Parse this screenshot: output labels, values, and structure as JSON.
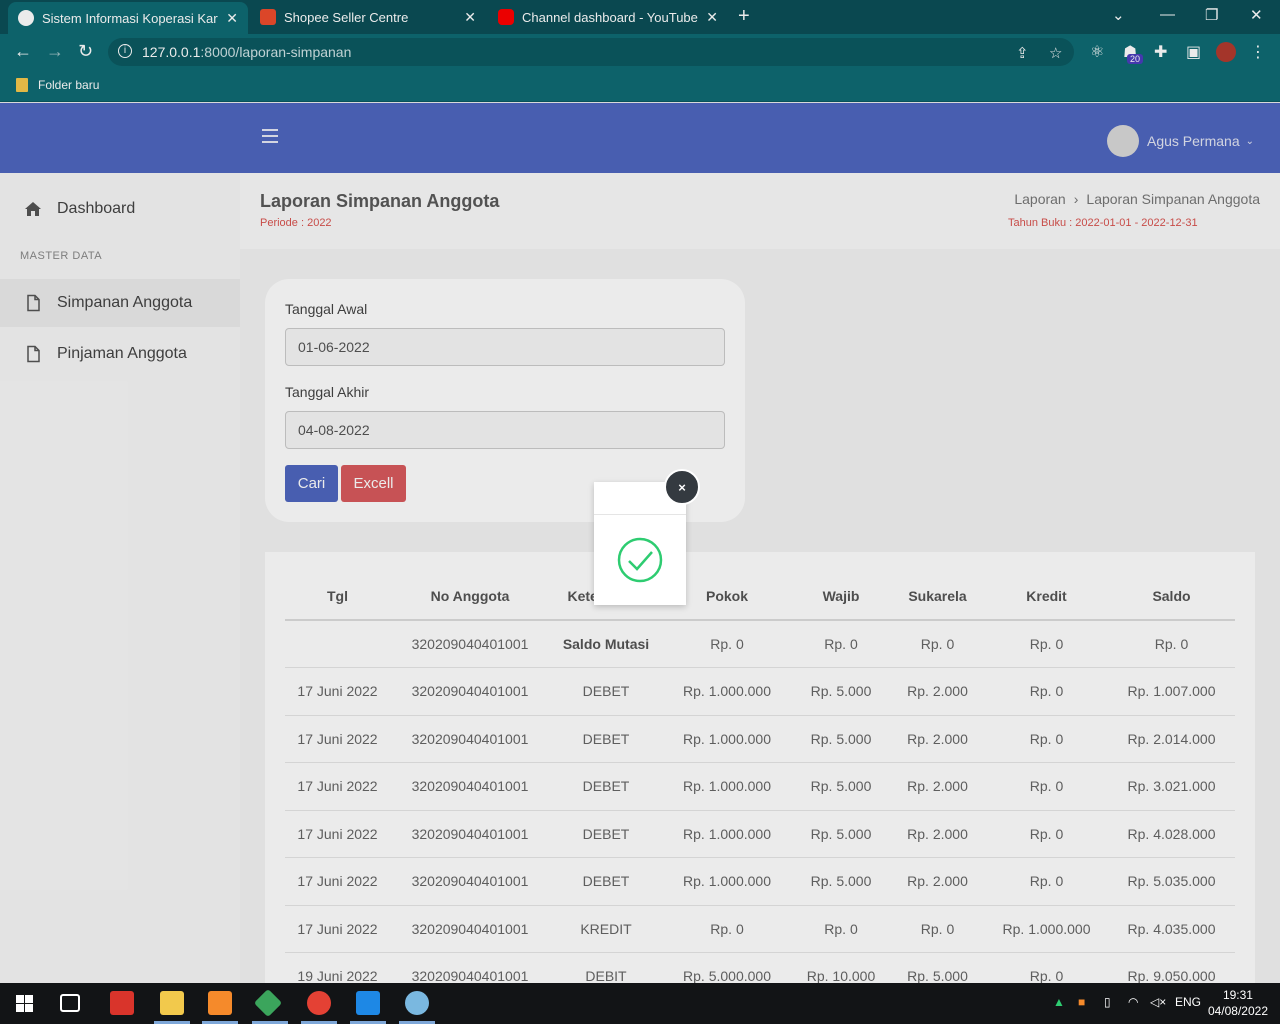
{
  "browser": {
    "tabs": [
      {
        "title": "Sistem Informasi Koperasi Karyaw",
        "active": true
      },
      {
        "title": "Shopee Seller Centre",
        "active": false
      },
      {
        "title": "Channel dashboard - YouTube St",
        "active": false
      }
    ],
    "url_host": "127.0.0.1",
    "url_path": ":8000/laporan-simpanan",
    "extension_badge": "20",
    "bookmark": "Folder baru"
  },
  "app": {
    "user_name": "Agus Permana",
    "sidebar": {
      "dashboard": "Dashboard",
      "section": "MASTER DATA",
      "simpanan": "Simpanan Anggota",
      "pinjaman": "Pinjaman Anggota"
    },
    "header": {
      "title": "Laporan Simpanan Anggota",
      "periode": "Periode : 2022",
      "crumb_parent": "Laporan",
      "crumb_current": "Laporan Simpanan Anggota",
      "tahun_buku": "Tahun Buku : 2022-01-01 - 2022-12-31"
    },
    "form": {
      "start_label": "Tanggal Awal",
      "start_value": "01-06-2022",
      "end_label": "Tanggal Akhir",
      "end_value": "04-08-2022",
      "search_button": "Cari",
      "excel_button": "Excell"
    },
    "table": {
      "headers": [
        "Tgl",
        "No Anggota",
        "Keterangan",
        "Pokok",
        "Wajib",
        "Sukarela",
        "Kredit",
        "Saldo"
      ],
      "rows": [
        [
          "",
          "320209040401001",
          "Saldo Mutasi",
          "Rp. 0",
          "Rp. 0",
          "Rp. 0",
          "Rp. 0",
          "Rp. 0"
        ],
        [
          "17 Juni 2022",
          "320209040401001",
          "DEBET",
          "Rp. 1.000.000",
          "Rp. 5.000",
          "Rp. 2.000",
          "Rp. 0",
          "Rp. 1.007.000"
        ],
        [
          "17 Juni 2022",
          "320209040401001",
          "DEBET",
          "Rp. 1.000.000",
          "Rp. 5.000",
          "Rp. 2.000",
          "Rp. 0",
          "Rp. 2.014.000"
        ],
        [
          "17 Juni 2022",
          "320209040401001",
          "DEBET",
          "Rp. 1.000.000",
          "Rp. 5.000",
          "Rp. 2.000",
          "Rp. 0",
          "Rp. 3.021.000"
        ],
        [
          "17 Juni 2022",
          "320209040401001",
          "DEBET",
          "Rp. 1.000.000",
          "Rp. 5.000",
          "Rp. 2.000",
          "Rp. 0",
          "Rp. 4.028.000"
        ],
        [
          "17 Juni 2022",
          "320209040401001",
          "DEBET",
          "Rp. 1.000.000",
          "Rp. 5.000",
          "Rp. 2.000",
          "Rp. 0",
          "Rp. 5.035.000"
        ],
        [
          "17 Juni 2022",
          "320209040401001",
          "KREDIT",
          "Rp. 0",
          "Rp. 0",
          "Rp. 0",
          "Rp. 1.000.000",
          "Rp. 4.035.000"
        ],
        [
          "19 Juni 2022",
          "320209040401001",
          "DEBIT",
          "Rp. 5.000.000",
          "Rp. 10.000",
          "Rp. 5.000",
          "Rp. 0",
          "Rp. 9.050.000"
        ]
      ]
    },
    "modal": {
      "close_symbol": "×"
    }
  },
  "taskbar": {
    "language": "ENG",
    "time": "19:31",
    "date": "04/08/2022"
  }
}
